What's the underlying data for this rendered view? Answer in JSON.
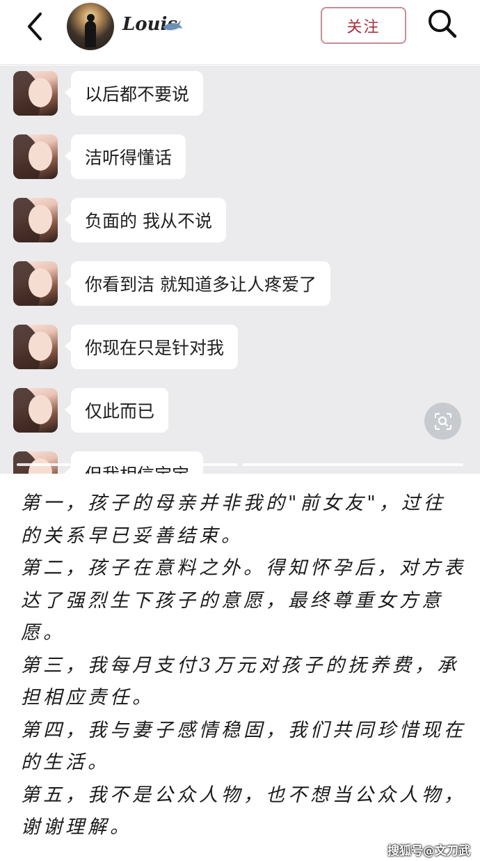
{
  "header": {
    "username": "Louis",
    "follow_label": "关注"
  },
  "chat": {
    "messages": [
      "以后都不要说",
      "洁听得懂话",
      "负面的 我从不说",
      "你看到洁 就知道多让人疼爱了",
      "你现在只是针对我",
      "仅此而已",
      "但我相信宝宝"
    ]
  },
  "statement": {
    "paragraphs": [
      "第一，孩子的母亲并非我的\"前女友\"，过往的关系早已妥善结束。",
      "第二，孩子在意料之外。得知怀孕后，对方表达了强烈生下孩子的意愿，最终尊重女方意愿。",
      "第三，我每月支付3万元对孩子的抚养费，承担相应责任。",
      "第四，我与妻子感情稳固，我们共同珍惜现在的生活。",
      "第五，我不是公众人物，也不想当公众人物，谢谢理解。"
    ]
  },
  "watermark": "搜狐号@文刀武",
  "colors": {
    "follow_border": "#c78d95",
    "follow_text": "#a5303f",
    "chat_bg": "#ebebed"
  },
  "icons": [
    "back-arrow-icon",
    "shark-emoji-icon",
    "search-icon",
    "image-scan-icon"
  ]
}
